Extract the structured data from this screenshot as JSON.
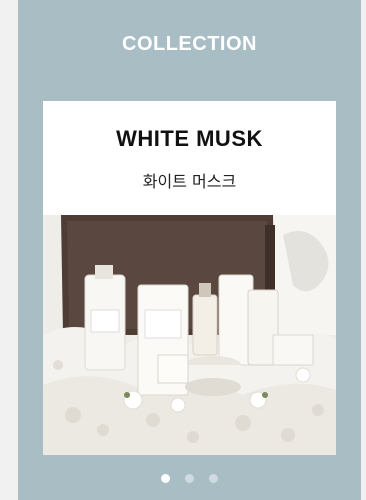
{
  "section": {
    "title": "COLLECTION"
  },
  "slide": {
    "name": "WHITE MUSK",
    "subname": "화이트 머스크",
    "image_alt": "White musk products gift set"
  },
  "carousel": {
    "total": 3,
    "active_index": 0
  },
  "colors": {
    "panel": "#a9bdc5",
    "card": "#ffffff"
  }
}
